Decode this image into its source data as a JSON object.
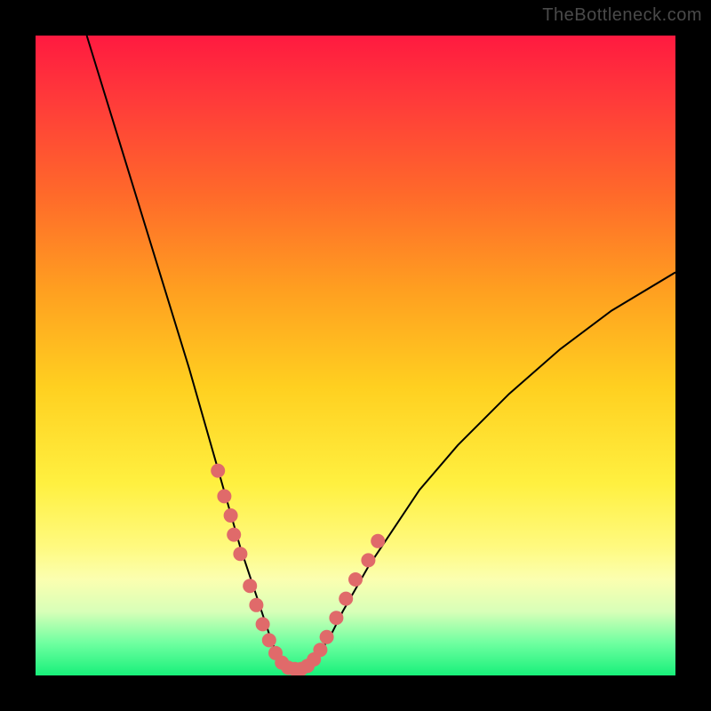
{
  "watermark": "TheBottleneck.com",
  "chart_data": {
    "type": "line",
    "title": "",
    "xlabel": "",
    "ylabel": "",
    "xlim": [
      0,
      100
    ],
    "ylim": [
      0,
      100
    ],
    "grid": false,
    "background_gradient": {
      "orientation": "vertical",
      "stops": [
        {
          "pos": 0.0,
          "color": "#ff1a40"
        },
        {
          "pos": 0.1,
          "color": "#ff3a3a"
        },
        {
          "pos": 0.25,
          "color": "#ff6a2a"
        },
        {
          "pos": 0.4,
          "color": "#ffa020"
        },
        {
          "pos": 0.55,
          "color": "#ffd020"
        },
        {
          "pos": 0.7,
          "color": "#fff040"
        },
        {
          "pos": 0.8,
          "color": "#fffa80"
        },
        {
          "pos": 0.85,
          "color": "#fbffb0"
        },
        {
          "pos": 0.9,
          "color": "#d8ffb8"
        },
        {
          "pos": 0.95,
          "color": "#6effa0"
        },
        {
          "pos": 1.0,
          "color": "#18f07a"
        }
      ]
    },
    "series": [
      {
        "name": "bottleneck-curve",
        "color": "#000000",
        "stroke_width": 2,
        "x": [
          8,
          12,
          16,
          20,
          24,
          28,
          30,
          32,
          34,
          36,
          37,
          38,
          39,
          40,
          41,
          42,
          43,
          44,
          46,
          48,
          52,
          56,
          60,
          66,
          74,
          82,
          90,
          100
        ],
        "y": [
          100,
          87,
          74,
          61,
          48,
          34,
          27,
          20,
          14,
          8,
          5,
          3,
          1.5,
          1,
          1,
          1.2,
          1.8,
          3,
          6,
          10,
          17,
          23,
          29,
          36,
          44,
          51,
          57,
          63
        ]
      }
    ],
    "markers": {
      "name": "data-points",
      "color": "#e06a6a",
      "radius": 8,
      "x": [
        28.5,
        29.5,
        30.5,
        31.0,
        32.0,
        33.5,
        34.5,
        35.5,
        36.5,
        37.5,
        38.5,
        39.5,
        40.5,
        41.5,
        42.5,
        43.5,
        44.5,
        45.5,
        47.0,
        48.5,
        50.0,
        52.0,
        53.5
      ],
      "y": [
        32.0,
        28.0,
        25.0,
        22.0,
        19.0,
        14.0,
        11.0,
        8.0,
        5.5,
        3.5,
        2.0,
        1.2,
        1.0,
        1.0,
        1.5,
        2.5,
        4.0,
        6.0,
        9.0,
        12.0,
        15.0,
        18.0,
        21.0
      ]
    }
  }
}
